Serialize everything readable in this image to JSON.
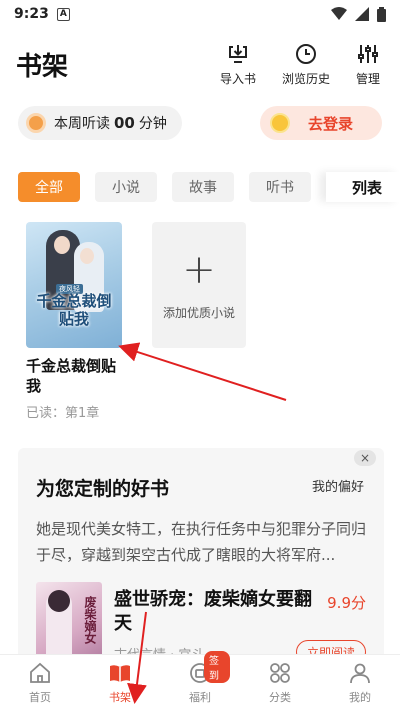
{
  "status_bar": {
    "time": "9:23",
    "notif_letter": "A"
  },
  "header": {
    "title": "书架",
    "actions": [
      {
        "label": "导入书",
        "icon": "import-icon"
      },
      {
        "label": "浏览历史",
        "icon": "history-clock-icon"
      },
      {
        "label": "管理",
        "icon": "settings-sliders-icon"
      }
    ]
  },
  "listen": {
    "prefix": "本周听读",
    "value": "00",
    "unit": "分钟"
  },
  "login": {
    "label": "去登录"
  },
  "tabs": [
    "全部",
    "小说",
    "故事",
    "听书"
  ],
  "list_toggle": "列表",
  "shelf": {
    "book": {
      "title": "千金总裁倒贴我",
      "progress": "已读：第1章",
      "cover_title": "千金总裁倒贴我",
      "cover_ribbon": "夜风轻"
    },
    "add_label": "添加优质小说"
  },
  "recommend": {
    "close": "×",
    "title": "为您定制的好书",
    "preference": "我的偏好",
    "description": "她是现代美女特工，在执行任务中与犯罪分子同归于尽，穿越到架空古代成了瞎眼的大将军府...",
    "book": {
      "title": "盛世骄宠：废柴嫡女要翻天",
      "price": "9.9分",
      "genre": "古代言情 · 宫斗",
      "read_btn": "立即阅读",
      "cover_text": "废柴嫡女"
    }
  },
  "bottom_nav": [
    {
      "label": "首页",
      "icon": "home-icon"
    },
    {
      "label": "书架",
      "icon": "bookshelf-icon",
      "active": true
    },
    {
      "label": "福利",
      "icon": "welfare-icon",
      "badge": "签到"
    },
    {
      "label": "分类",
      "icon": "category-grid-icon"
    },
    {
      "label": "我的",
      "icon": "profile-icon"
    }
  ],
  "colors": {
    "accent": "#f58d2b",
    "red": "#e8452c"
  }
}
